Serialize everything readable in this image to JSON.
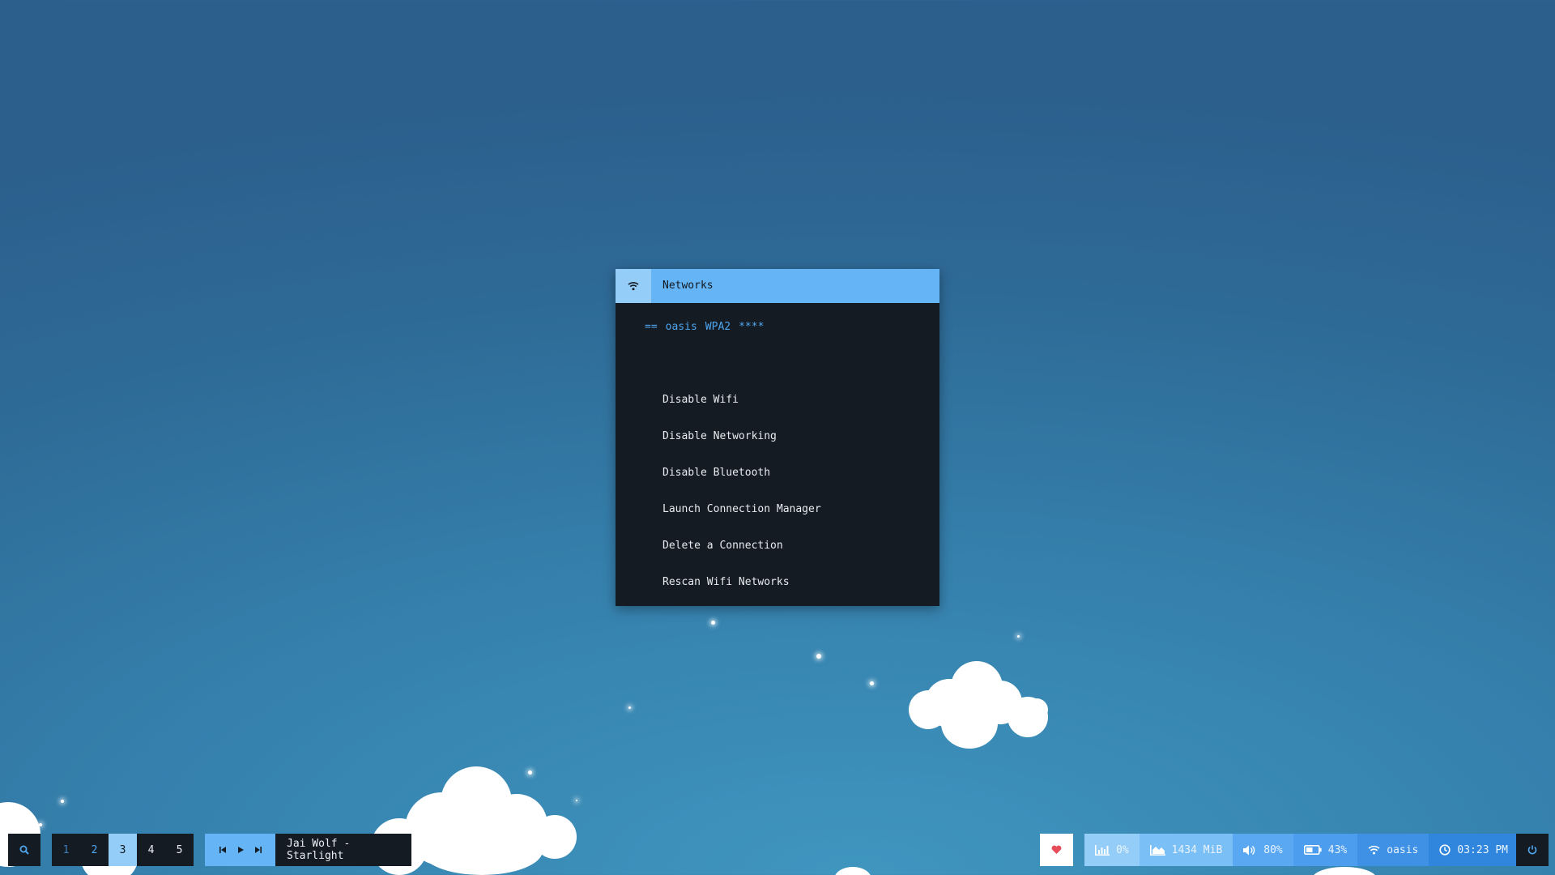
{
  "network_menu": {
    "title": "Networks",
    "active_network": {
      "marker": "==",
      "ssid": "oasis",
      "security": "WPA2",
      "signal": "****"
    },
    "items": [
      "Disable Wifi",
      "Disable Networking",
      "Disable Bluetooth",
      "Launch Connection Manager",
      "Delete a Connection",
      "Rescan Wifi Networks"
    ]
  },
  "bar": {
    "workspaces": [
      "1",
      "2",
      "3",
      "4",
      "5"
    ],
    "active_workspace": "3",
    "now_playing": "Jai Wolf - Starlight",
    "cpu": "0%",
    "memory": "1434 MiB",
    "volume": "80%",
    "battery": "43%",
    "wifi": "oasis",
    "clock": "03:23 PM"
  },
  "colors": {
    "accent": "#65b5f6",
    "accent_light": "#94cdf8",
    "dark": "#151b23",
    "highlight_text": "#4ea6ef",
    "heart": "#e74c5b"
  },
  "icons": {
    "menu": "wifi-icon",
    "search": "search-icon",
    "media": [
      "previous-track-icon",
      "play-icon",
      "next-track-icon"
    ],
    "heart": "heart-icon",
    "cpu": "bar-chart-icon",
    "memory": "area-chart-icon",
    "volume": "volume-icon",
    "battery": "battery-icon",
    "wifi": "wifi-icon",
    "clock": "clock-icon",
    "power": "power-icon"
  }
}
